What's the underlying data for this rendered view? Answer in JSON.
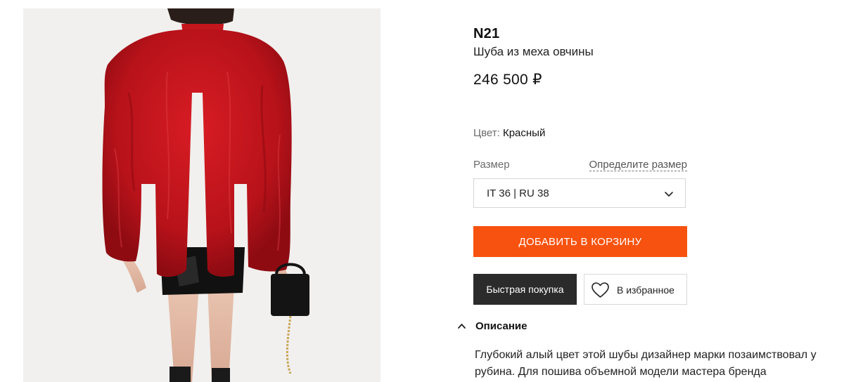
{
  "product": {
    "brand": "N21",
    "title": "Шуба из меха овчины",
    "price": "246 500 ₽",
    "color_label": "Цвет:",
    "color_value": "Красный",
    "size_label": "Размер",
    "size_guide_link": "Определите размер",
    "selected_size": "IT 36 | RU 38",
    "add_to_cart_label": "ДОБАВИТЬ В КОРЗИНУ",
    "quick_buy_label": "Быстрая покупка",
    "favorite_label": "В избранное",
    "description_heading": "Описание",
    "description_text": "Глубокий алый цвет этой шубы дизайнер марки позаимствовал у рубина. Для пошива объемной модели мастера бренда использовали мех овчины"
  },
  "colors": {
    "accent": "#f7520f",
    "quick_buy_bg": "#2b2b2b",
    "coat": "#c8141b",
    "photo_bg": "#f1f0ee"
  },
  "icons": {
    "size_dropdown": "chevron-down-icon",
    "favorite": "heart-outline-icon",
    "description_toggle": "chevron-up-icon"
  }
}
